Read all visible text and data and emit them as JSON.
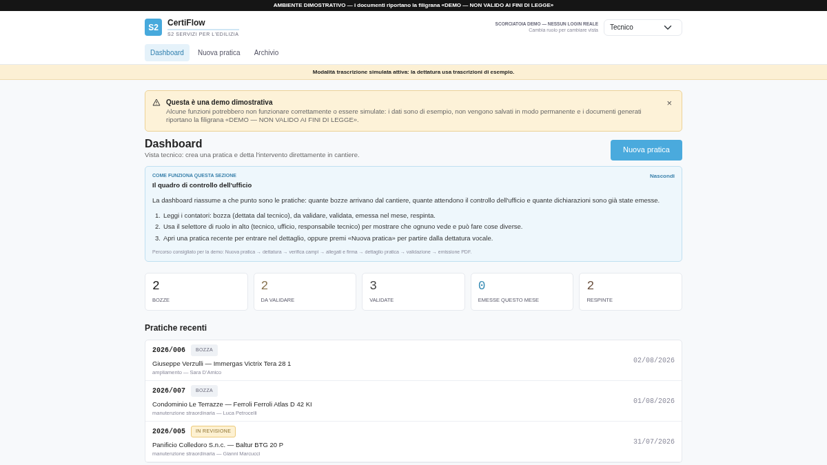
{
  "top_banner": "AMBIENTE DIMOSTRATIVO — i documenti riportano la filigrana «DEMO — NON VALIDO AI FINI DI LEGGE»",
  "brand": {
    "logo": "S2",
    "name": "CertiFlow",
    "tagline": "S2 SERVIZI PER L'EDILIZIA"
  },
  "role": {
    "title": "SCORCIATOIA DEMO — NESSUN LOGIN REALE",
    "hint": "Cambia ruolo per cambiare vista",
    "value": "Tecnico"
  },
  "nav": [
    {
      "label": "Dashboard",
      "selected": true
    },
    {
      "label": "Nuova pratica",
      "selected": false
    },
    {
      "label": "Archivio",
      "selected": false
    }
  ],
  "notice_bar": "Modalità trascrizione simulata attiva: la dettatura usa trascrizioni di esempio.",
  "alert": {
    "title": "Questa è una demo dimostrativa",
    "text": "Alcune funzioni potrebbero non funzionare correttamente o essere simulate: i dati sono di esempio, non vengono salvati in modo permanente e i documenti generati riportano la filigrana «DEMO — NON VALIDO AI FINI DI LEGGE».",
    "close": "×"
  },
  "header": {
    "title": "Dashboard",
    "subtitle": "Vista tecnico: crea una pratica e detta l'intervento direttamente in cantiere.",
    "button": "Nuova pratica"
  },
  "help": {
    "eyebrow": "COME FUNZIONA QUESTA SEZIONE",
    "hide": "Nascondi",
    "title": "Il quadro di controllo dell'ufficio",
    "intro": "La dashboard riassume a che punto sono le pratiche: quante bozze arrivano dal cantiere, quante attendono il controllo dell'ufficio e quante dichiarazioni sono già state emesse.",
    "steps": [
      {
        "number": "1.",
        "text": "Leggi i contatori: bozza (dettata dal tecnico), da validare, validata, emessa nel mese, respinta."
      },
      {
        "number": "2.",
        "text": "Usa il selettore di ruolo in alto (tecnico, ufficio, responsabile tecnico) per mostrare che ognuno vede e può fare cose diverse."
      },
      {
        "number": "3.",
        "text": "Apri una pratica recente per entrare nel dettaglio, oppure premi «Nuova pratica» per partire dalla dettatura vocale."
      }
    ],
    "footnote": "Percorso consigliato per la demo: Nuova pratica → dettatura → verifica campi → allegati e firma → dettaglio pratica → validazione → emissione PDF."
  },
  "stats": [
    {
      "value": "2",
      "label": "BOZZE",
      "color": "#1a1a1a"
    },
    {
      "value": "2",
      "label": "DA VALIDARE",
      "color": "#8a7552"
    },
    {
      "value": "3",
      "label": "VALIDATE",
      "color": "#444444"
    },
    {
      "value": "0",
      "label": "EMESSE QUESTO MESE",
      "color": "#3d8fb6"
    },
    {
      "value": "2",
      "label": "RESPINTE",
      "color": "#6e5442"
    }
  ],
  "recent_title": "Pratiche recenti",
  "recent": [
    {
      "code": "2026/006",
      "status": "BOZZA",
      "kind": "draft",
      "title": "Giuseppe Verzulli — Immergas Victrix Tera 28 1",
      "meta": "ampliamento — Sara D'Amico",
      "date": "02/08/2026"
    },
    {
      "code": "2026/007",
      "status": "BOZZA",
      "kind": "draft",
      "title": "Condominio Le Terrazze — Ferroli Ferroli Atlas D 42 KI",
      "meta": "manutenzione straordinaria — Luca Petrocelli",
      "date": "01/08/2026"
    },
    {
      "code": "2026/005",
      "status": "IN REVISIONE",
      "kind": "review",
      "title": "Panificio Colledoro S.n.c. — Baltur BTG 20 P",
      "meta": "manutenzione straordinaria — Gianni Marcucci",
      "date": "31/07/2026"
    }
  ]
}
